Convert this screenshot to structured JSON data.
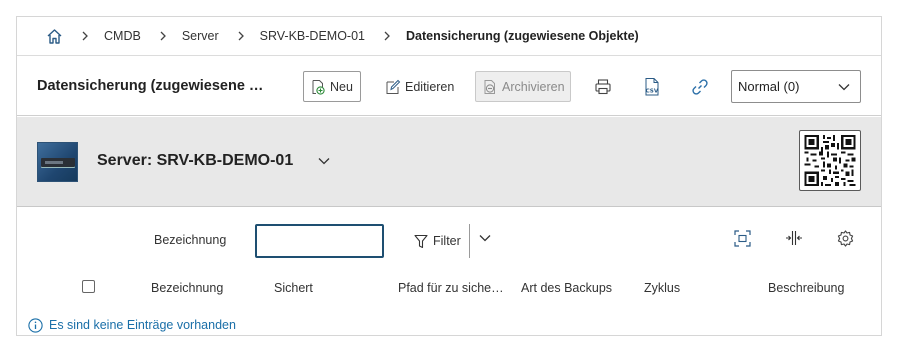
{
  "breadcrumb": {
    "home_icon": "home-icon",
    "items": [
      "CMDB",
      "Server",
      "SRV-KB-DEMO-01",
      "Datensicherung (zugewiesene Objekte)"
    ]
  },
  "toolbar": {
    "page_title": "Datensicherung (zugewiesene Objekte)",
    "new_label": "Neu",
    "edit_label": "Editieren",
    "archive_label": "Archivieren",
    "icons": [
      "print-icon",
      "csv-export-icon",
      "link-icon"
    ],
    "view_select": {
      "value": "Normal (0)"
    }
  },
  "object": {
    "title": "Server: SRV-KB-DEMO-01",
    "image_icon": "server-icon",
    "qr_icon": "qr-code-icon"
  },
  "filter": {
    "label": "Bezeichnung",
    "input_value": "",
    "filter_label": "Filter"
  },
  "table": {
    "columns": [
      "Bezeichnung",
      "Sichert",
      "Pfad für zu sichernde Daten",
      "Art des Backups",
      "Zyklus",
      "Beschreibung"
    ]
  },
  "info": {
    "message": "Es sind keine Einträge vorhanden"
  },
  "colors": {
    "accent": "#1e4f71",
    "link_blue": "#1a6fa8",
    "header_bg": "#e8e8e8"
  }
}
